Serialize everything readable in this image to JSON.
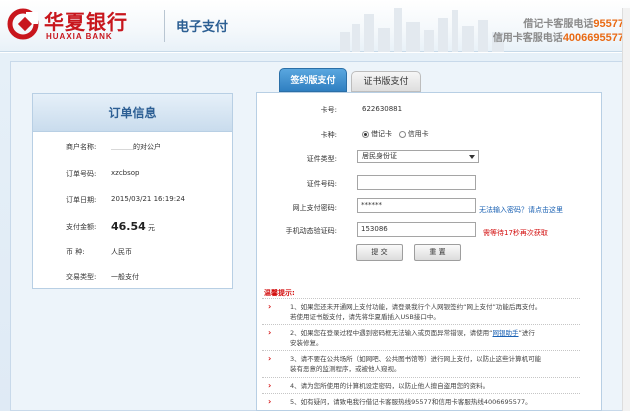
{
  "header": {
    "bank_name_cn": "华夏银行",
    "bank_name_en": "HUAXIA BANK",
    "section_title": "电子支付",
    "debit_hotline_label": "借记卡客服电话",
    "debit_hotline_number": "95577",
    "credit_hotline_label": "信用卡客服电话",
    "credit_hotline_number": "4006695577",
    "brand_color": "#c8161d"
  },
  "tabs": [
    {
      "label": "签约版支付",
      "active": true
    },
    {
      "label": "证书版支付",
      "active": false
    }
  ],
  "order": {
    "title": "订单信息",
    "merchant_label": "商户名称:",
    "merchant_value": "的对公户",
    "order_no_label": "订单号码:",
    "order_no_value": "xzcbsop",
    "order_date_label": "订单日期:",
    "order_date_value": "2015/03/21 16:19:24",
    "amount_label": "支付金额:",
    "amount_value": "46.54",
    "amount_unit": "元",
    "currency_label": "币    种:",
    "currency_value": "人民币",
    "txn_type_label": "交易类型:",
    "txn_type_value": "一般支付"
  },
  "form": {
    "card_no_label": "卡号:",
    "card_no_value": "622630881",
    "card_type_label": "卡种:",
    "card_type_debit": "借记卡",
    "card_type_credit": "信用卡",
    "id_type_label": "证件类型:",
    "id_type_value": "居民身份证",
    "id_no_label": "证件号码:",
    "id_no_value": "",
    "password_label": "网上支付密码:",
    "password_value": "******",
    "password_help": "无法输入密码？请点击这里",
    "sms_label": "手机动态验证码:",
    "sms_value": "153086",
    "sms_wait": "需等待17秒再次获取",
    "submit_label": "提 交",
    "reset_label": "重 置"
  },
  "tips": {
    "title": "温馨提示:",
    "items": [
      {
        "line1": "1、如果您还未开通网上支付功能，请登录我行个人网银签约“网上支付”功能后再支付。",
        "line2": "若使用证书版支付，请先将华夏盾插入USB接口中。"
      },
      {
        "line1_pre": "2、如果您在登录过程中遇到密码框无法输入或页面异常错误，请使用“",
        "link": "网银助手",
        "line1_post": "”进行",
        "line2": "安装修复。"
      },
      {
        "line1": "3、请不要在公共场所（如网吧、公共图书馆等）进行网上支付，以防止这些计算机可能",
        "line2": "装有恶意的监测程序，或被他人窥视。"
      },
      {
        "line1": "4、请为您所使用的计算机设定密码，以防止他人擅自盗用您的资料。",
        "line2": ""
      },
      {
        "line1": "5、如有疑问，请致电我行借记卡客服热线95577和信用卡客服热线4006695577。",
        "line2": ""
      }
    ]
  }
}
